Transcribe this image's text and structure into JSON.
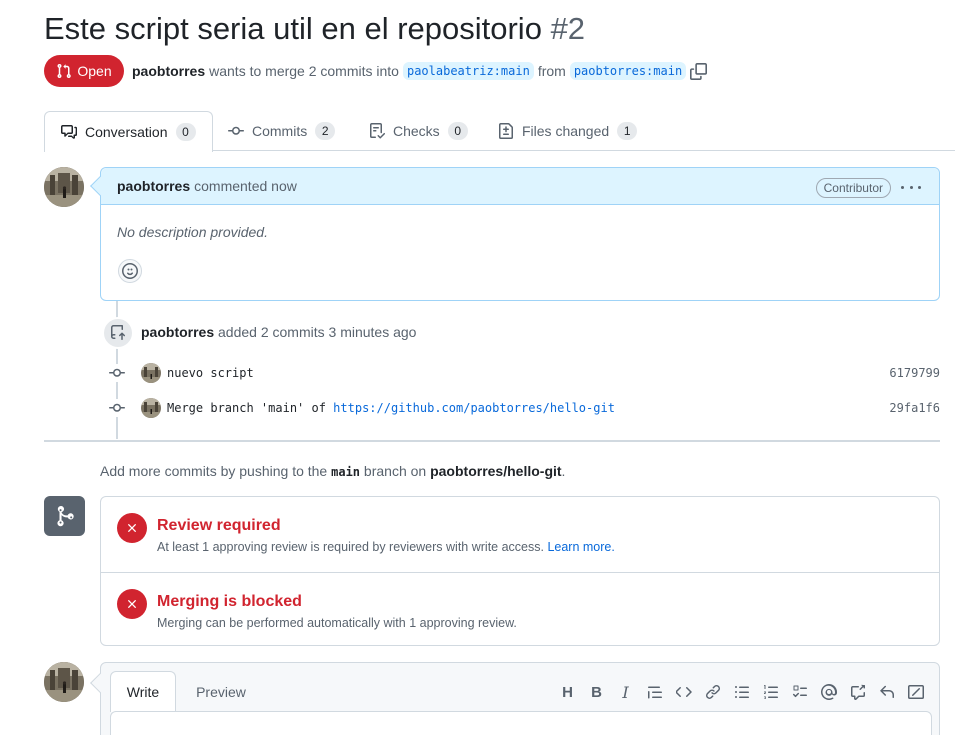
{
  "pr": {
    "title": "Este script seria util en el repositorio",
    "number": "#2",
    "state": "Open",
    "author": "paobtorres",
    "summary_mid": "wants to merge 2 commits into",
    "base_branch": "paolabeatriz:main",
    "from_text": "from",
    "head_branch": "paobtorres:main"
  },
  "tabs": [
    {
      "label": "Conversation",
      "count": "0",
      "icon": "comment-discussion-icon"
    },
    {
      "label": "Commits",
      "count": "2",
      "icon": "git-commit-icon"
    },
    {
      "label": "Checks",
      "count": "0",
      "icon": "checklist-icon"
    },
    {
      "label": "Files changed",
      "count": "1",
      "icon": "file-diff-icon"
    }
  ],
  "comment": {
    "author": "paobtorres",
    "action": "commented now",
    "badge": "Contributor",
    "body": "No description provided."
  },
  "push_event": {
    "author": "paobtorres",
    "text": "added 2 commits 3 minutes ago"
  },
  "commits": [
    {
      "message": "nuevo script",
      "link": "",
      "sha": "6179799"
    },
    {
      "message": "Merge branch 'main' of ",
      "link": "https://github.com/paobtorres/hello-git",
      "sha": "29fa1f6"
    }
  ],
  "hint": {
    "prefix": "Add more commits by pushing to the",
    "branch": "main",
    "mid": "branch on",
    "repo": "paobtorres/hello-git",
    "suffix": "."
  },
  "merge": {
    "review_title": "Review required",
    "review_desc": "At least 1 approving review is required by reviewers with write access.",
    "review_link": "Learn more.",
    "blocked_title": "Merging is blocked",
    "blocked_desc": "Merging can be performed automatically with 1 approving review."
  },
  "composer": {
    "write_tab": "Write",
    "preview_tab": "Preview",
    "tools": [
      "heading-icon",
      "bold-icon",
      "italic-icon",
      "quote-icon",
      "code-icon",
      "link-icon",
      "unordered-list-icon",
      "ordered-list-icon",
      "tasklist-icon",
      "mention-icon",
      "cross-reference-icon",
      "reply-icon",
      "fullscreen-icon"
    ]
  },
  "colors": {
    "danger": "#d1242f",
    "accent": "#0969da",
    "branch_bg": "#ddf4ff",
    "muted": "#59636e"
  }
}
